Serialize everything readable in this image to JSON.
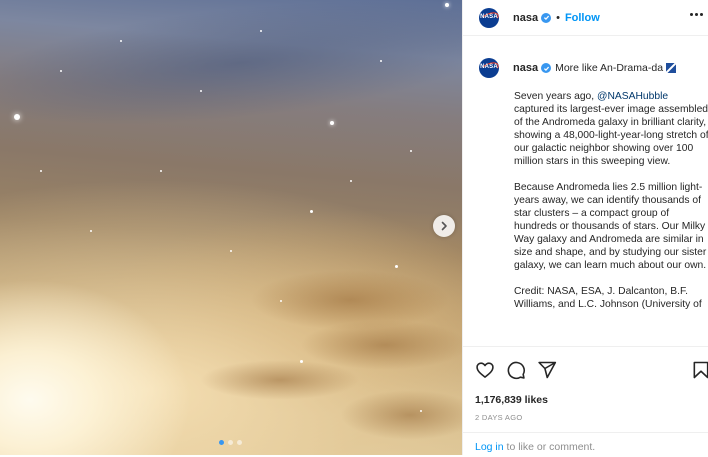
{
  "post": {
    "username": "nasa",
    "follow_label": "Follow",
    "separator": "•",
    "avatar_text": "NASA"
  },
  "caption": {
    "username": "nasa",
    "title": "More like An-Drama-da",
    "para1_pre": "Seven years ago, ",
    "para1_mention": "@NASAHubble",
    "para1_post": " captured its largest-ever image assembled of the Andromeda galaxy in brilliant clarity, showing a 48,000-light-year-long stretch of our galactic neighbor showing over 100 million stars in this sweeping view.",
    "para2": "Because Andromeda lies 2.5 million light-years away, we can identify thousands of star clusters – a compact group of hundreds or thousands of stars. Our Milky Way galaxy and Andromeda are similar in size and shape, and by studying our sister galaxy, we can learn much about our own.",
    "para3": "Credit: NASA, ESA, J. Dalcanton, B.F. Williams, and L.C. Johnson (University of"
  },
  "stats": {
    "likes": "1,176,839 likes",
    "date": "2 DAYS AGO"
  },
  "footer": {
    "login_label": "Log in",
    "login_suffix": " to like or comment."
  },
  "carousel": {
    "slide_count": 3,
    "active_index": 0
  },
  "icons": [
    "heart-icon",
    "comment-icon",
    "share-icon",
    "bookmark-icon",
    "more-icon",
    "verified-icon",
    "chevron-right-icon"
  ],
  "colors": {
    "link": "#0095f6",
    "verified": "#3897f0",
    "mention": "#00376b"
  }
}
